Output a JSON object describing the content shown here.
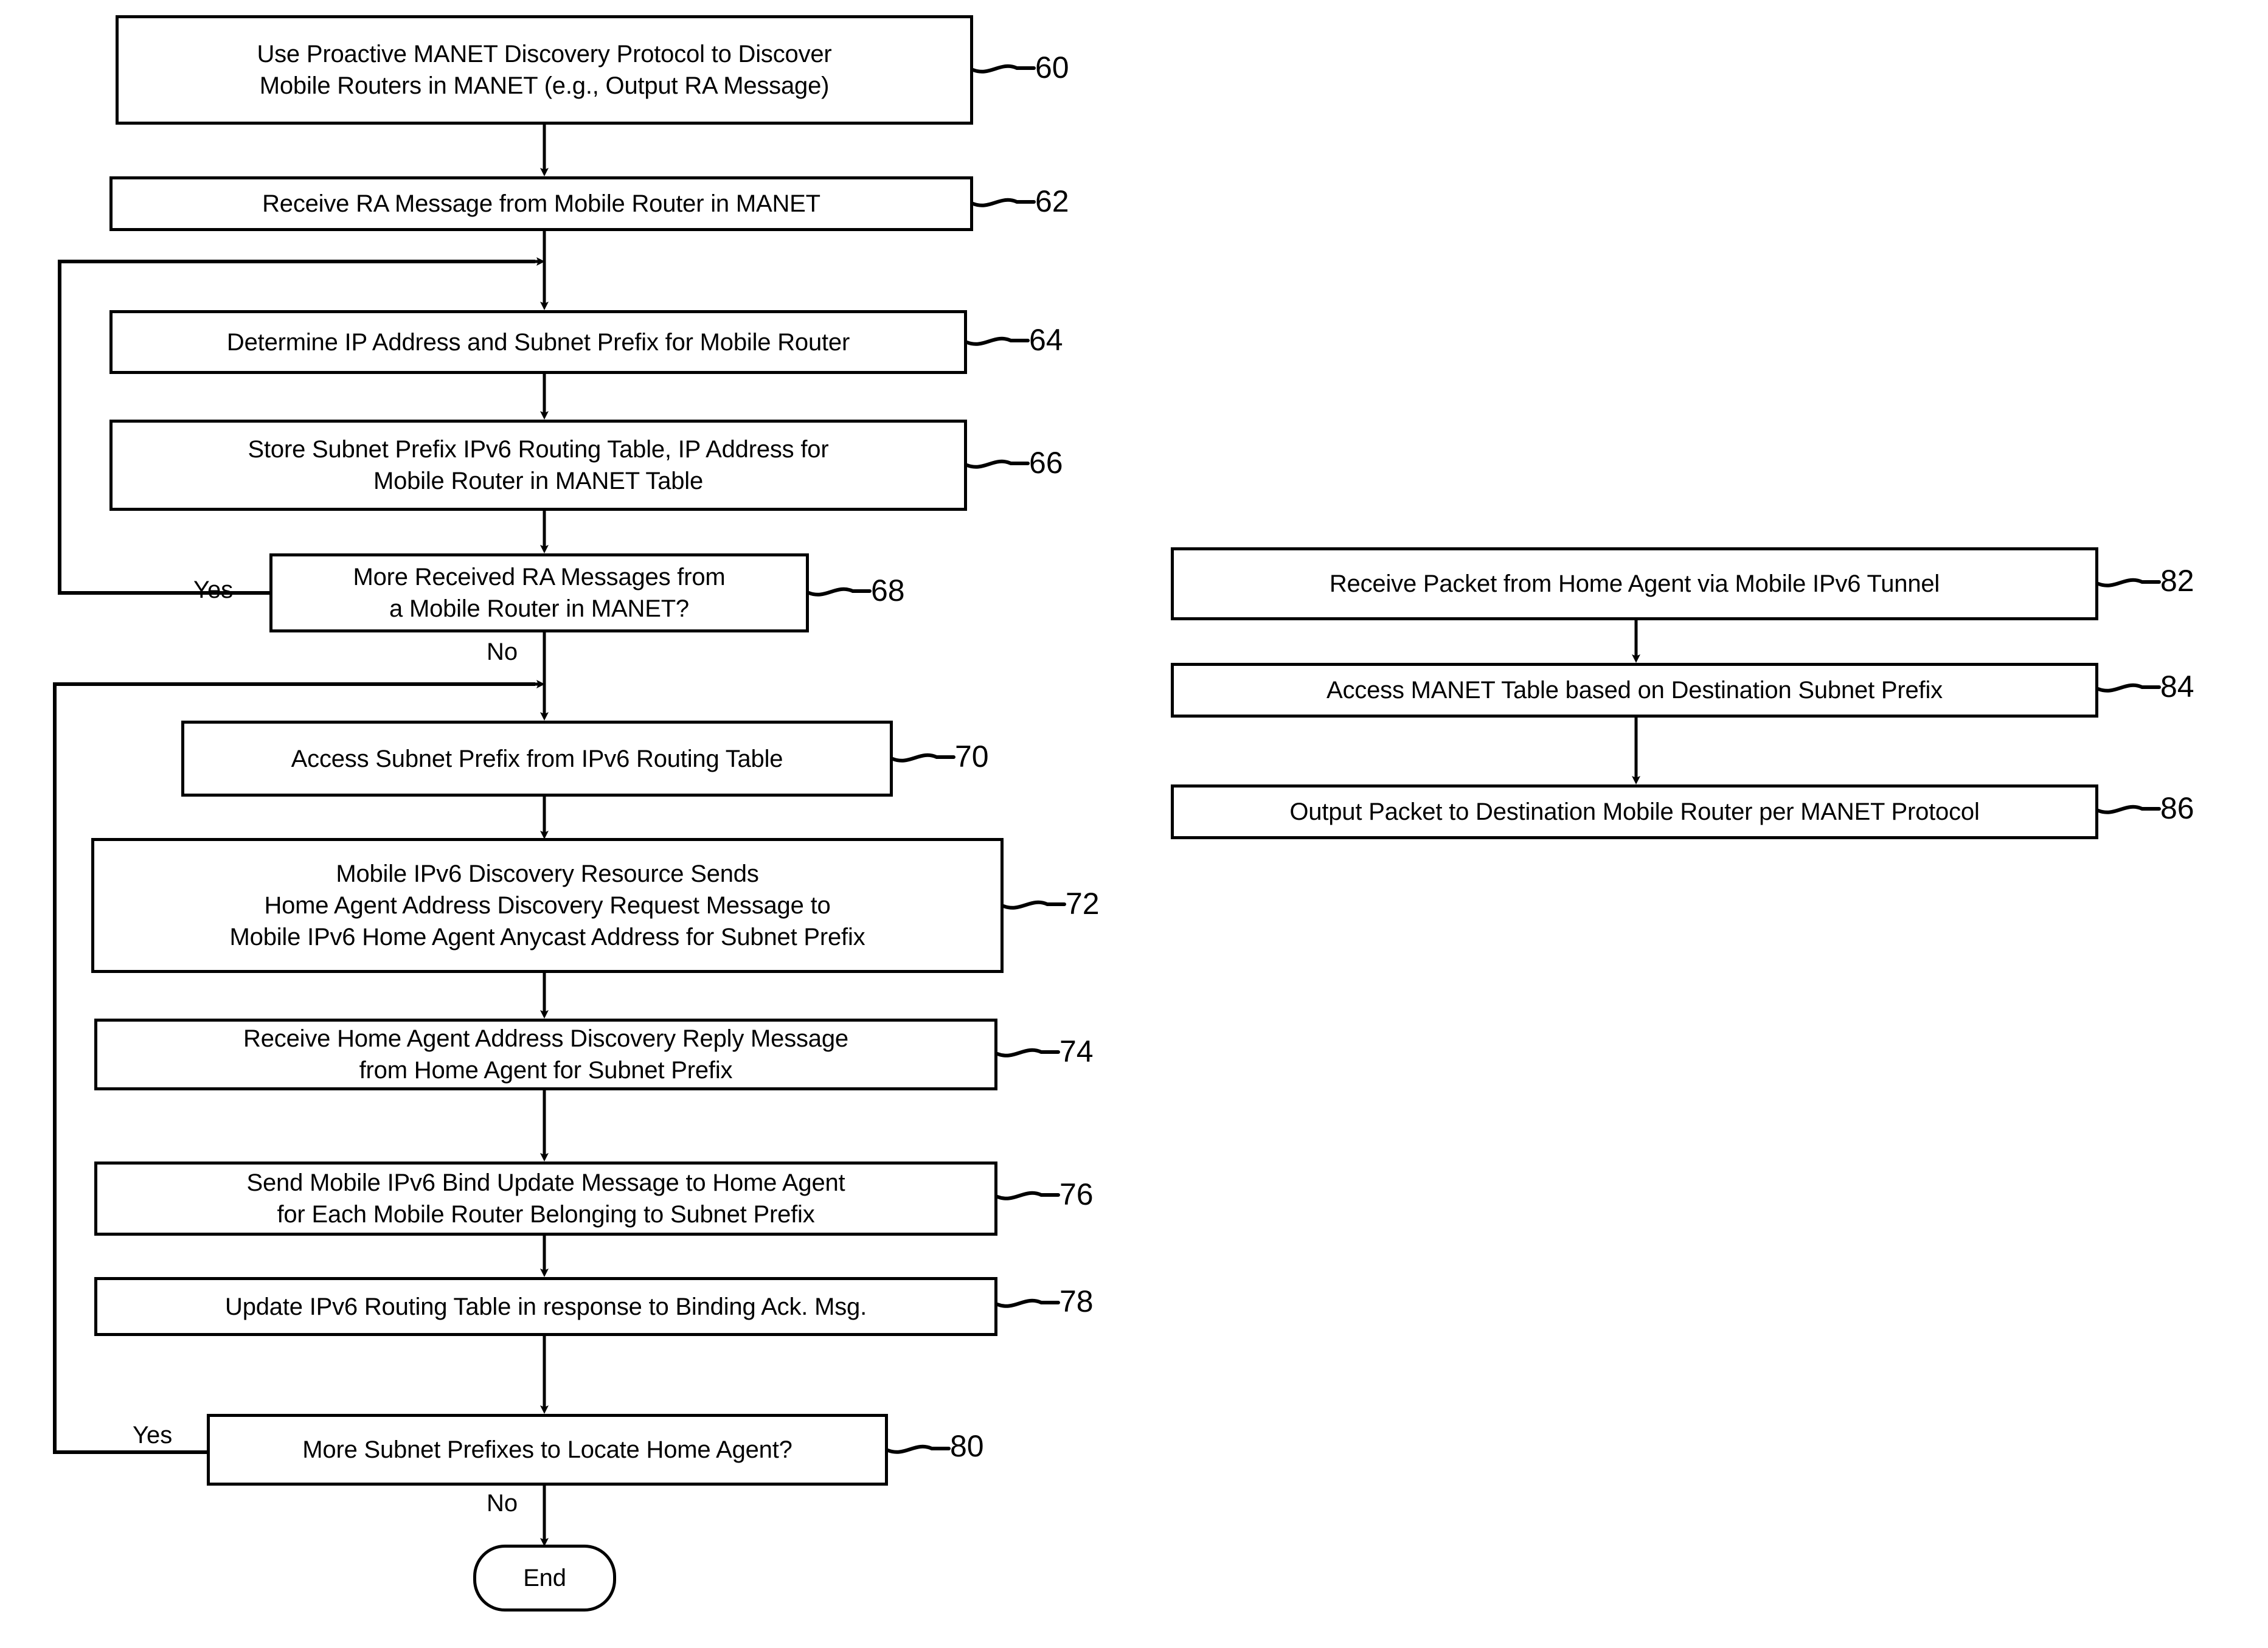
{
  "figure": {
    "type": "patent-flowchart",
    "background_color": "#ffffff",
    "line_color": "#000000"
  },
  "left_flow": {
    "nodes": [
      {
        "ref": "60",
        "shape": "process",
        "lines": [
          "Use Proactive MANET Discovery Protocol to Discover",
          "Mobile Routers in MANET (e.g., Output RA Message)"
        ]
      },
      {
        "ref": "62",
        "shape": "process",
        "lines": [
          "Receive RA Message from Mobile Router in MANET"
        ]
      },
      {
        "ref": "64",
        "shape": "process",
        "lines": [
          "Determine IP Address and Subnet Prefix for Mobile Router"
        ]
      },
      {
        "ref": "66",
        "shape": "process",
        "lines": [
          "Store Subnet Prefix IPv6 Routing Table, IP Address for",
          "Mobile Router in MANET Table"
        ]
      },
      {
        "ref": "68",
        "shape": "decision",
        "lines": [
          "More Received RA Messages from",
          "a Mobile Router in MANET?"
        ],
        "branch_yes": "Yes",
        "branch_no": "No"
      },
      {
        "ref": "70",
        "shape": "process",
        "lines": [
          "Access Subnet Prefix from IPv6 Routing Table"
        ]
      },
      {
        "ref": "72",
        "shape": "process",
        "lines": [
          "Mobile IPv6 Discovery Resource Sends",
          "Home Agent Address Discovery Request Message to",
          "Mobile IPv6 Home Agent Anycast Address for Subnet Prefix"
        ]
      },
      {
        "ref": "74",
        "shape": "process",
        "lines": [
          "Receive Home Agent Address Discovery Reply Message",
          "from Home Agent for Subnet Prefix"
        ]
      },
      {
        "ref": "76",
        "shape": "process",
        "lines": [
          "Send Mobile IPv6 Bind Update Message to Home  Agent",
          "for Each Mobile Router Belonging to Subnet Prefix"
        ]
      },
      {
        "ref": "78",
        "shape": "process",
        "lines": [
          "Update IPv6 Routing Table in response to Binding Ack. Msg."
        ]
      },
      {
        "ref": "80",
        "shape": "decision",
        "lines": [
          "More Subnet Prefixes to Locate Home Agent?"
        ],
        "branch_yes": "Yes",
        "branch_no": "No"
      },
      {
        "ref": "",
        "shape": "terminator",
        "lines": [
          "End"
        ]
      }
    ]
  },
  "right_flow": {
    "nodes": [
      {
        "ref": "82",
        "shape": "process",
        "lines": [
          "Receive Packet from Home Agent via Mobile IPv6 Tunnel"
        ]
      },
      {
        "ref": "84",
        "shape": "process",
        "lines": [
          "Access MANET Table based on Destination Subnet Prefix"
        ]
      },
      {
        "ref": "86",
        "shape": "process",
        "lines": [
          "Output Packet to Destination Mobile Router per MANET Protocol"
        ]
      }
    ]
  },
  "labels": {
    "yes_68": "Yes",
    "no_68": "No",
    "yes_80": "Yes",
    "no_80": "No"
  }
}
